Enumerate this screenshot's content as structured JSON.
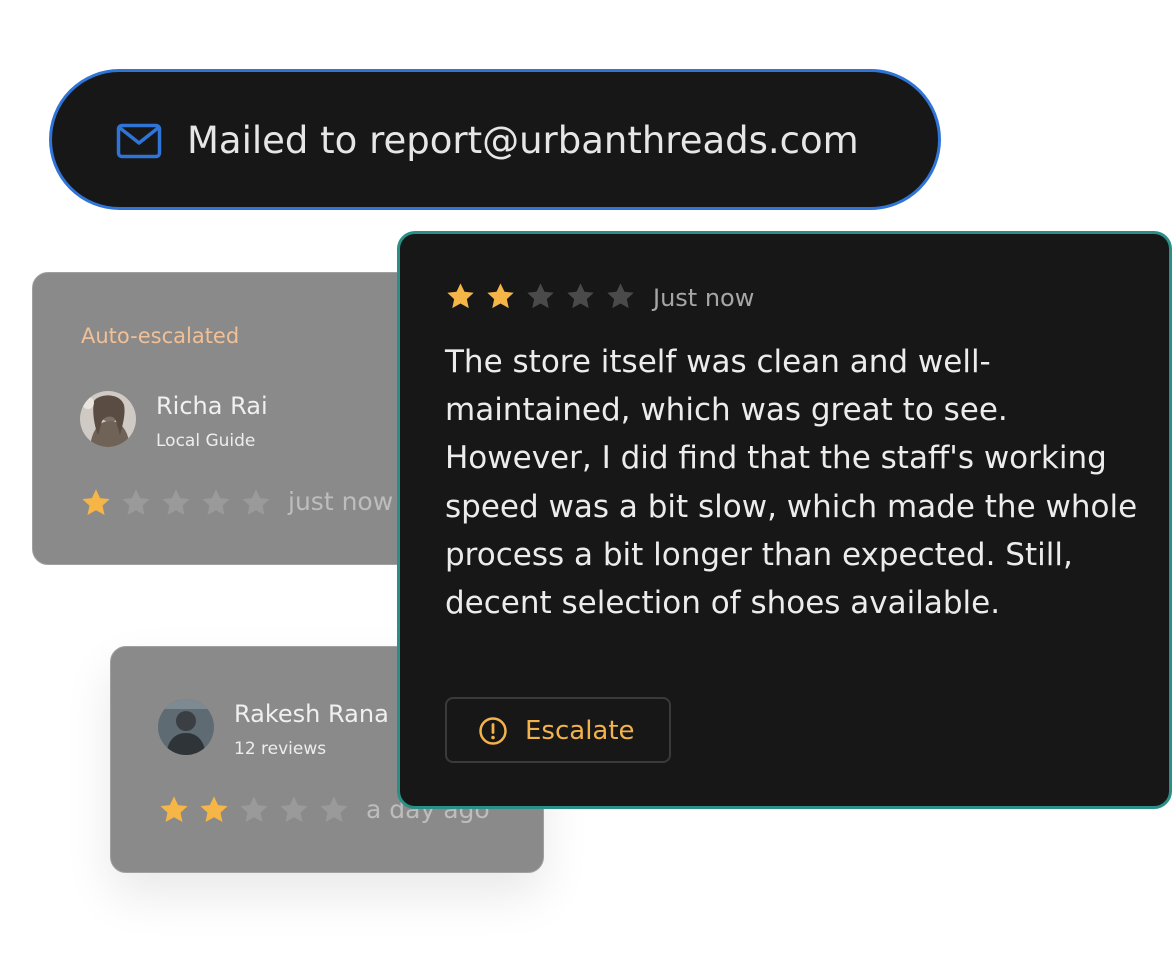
{
  "mail_banner": {
    "icon": "mail-icon",
    "text": "Mailed to report@urbanthreads.com",
    "accent_color": "#2f74d6"
  },
  "background_reviews": [
    {
      "status_label": "Auto-escalated",
      "reviewer": "Richa Rai",
      "subtitle": "Local Guide",
      "rating": 1,
      "max_rating": 5,
      "time": "just now"
    },
    {
      "reviewer": "Rakesh Rana",
      "subtitle": "12 reviews",
      "rating": 2,
      "max_rating": 5,
      "time": "a day ago"
    }
  ],
  "featured_review": {
    "rating": 2,
    "max_rating": 5,
    "time": "Just now",
    "text": "The store itself was clean and well-maintained, which was great to see. However, I did find that the staff's working speed was a bit slow, which made the whole process a bit longer than expected. Still, decent selection of shoes available.",
    "action_label": "Escalate",
    "action_icon": "alert-circle-icon",
    "border_color": "#2a8f86",
    "action_color": "#f2b24c"
  },
  "colors": {
    "star_filled": "#f5b547",
    "star_empty_dark": "#4a4a4a",
    "star_empty_gray": "#9a9a9a"
  }
}
